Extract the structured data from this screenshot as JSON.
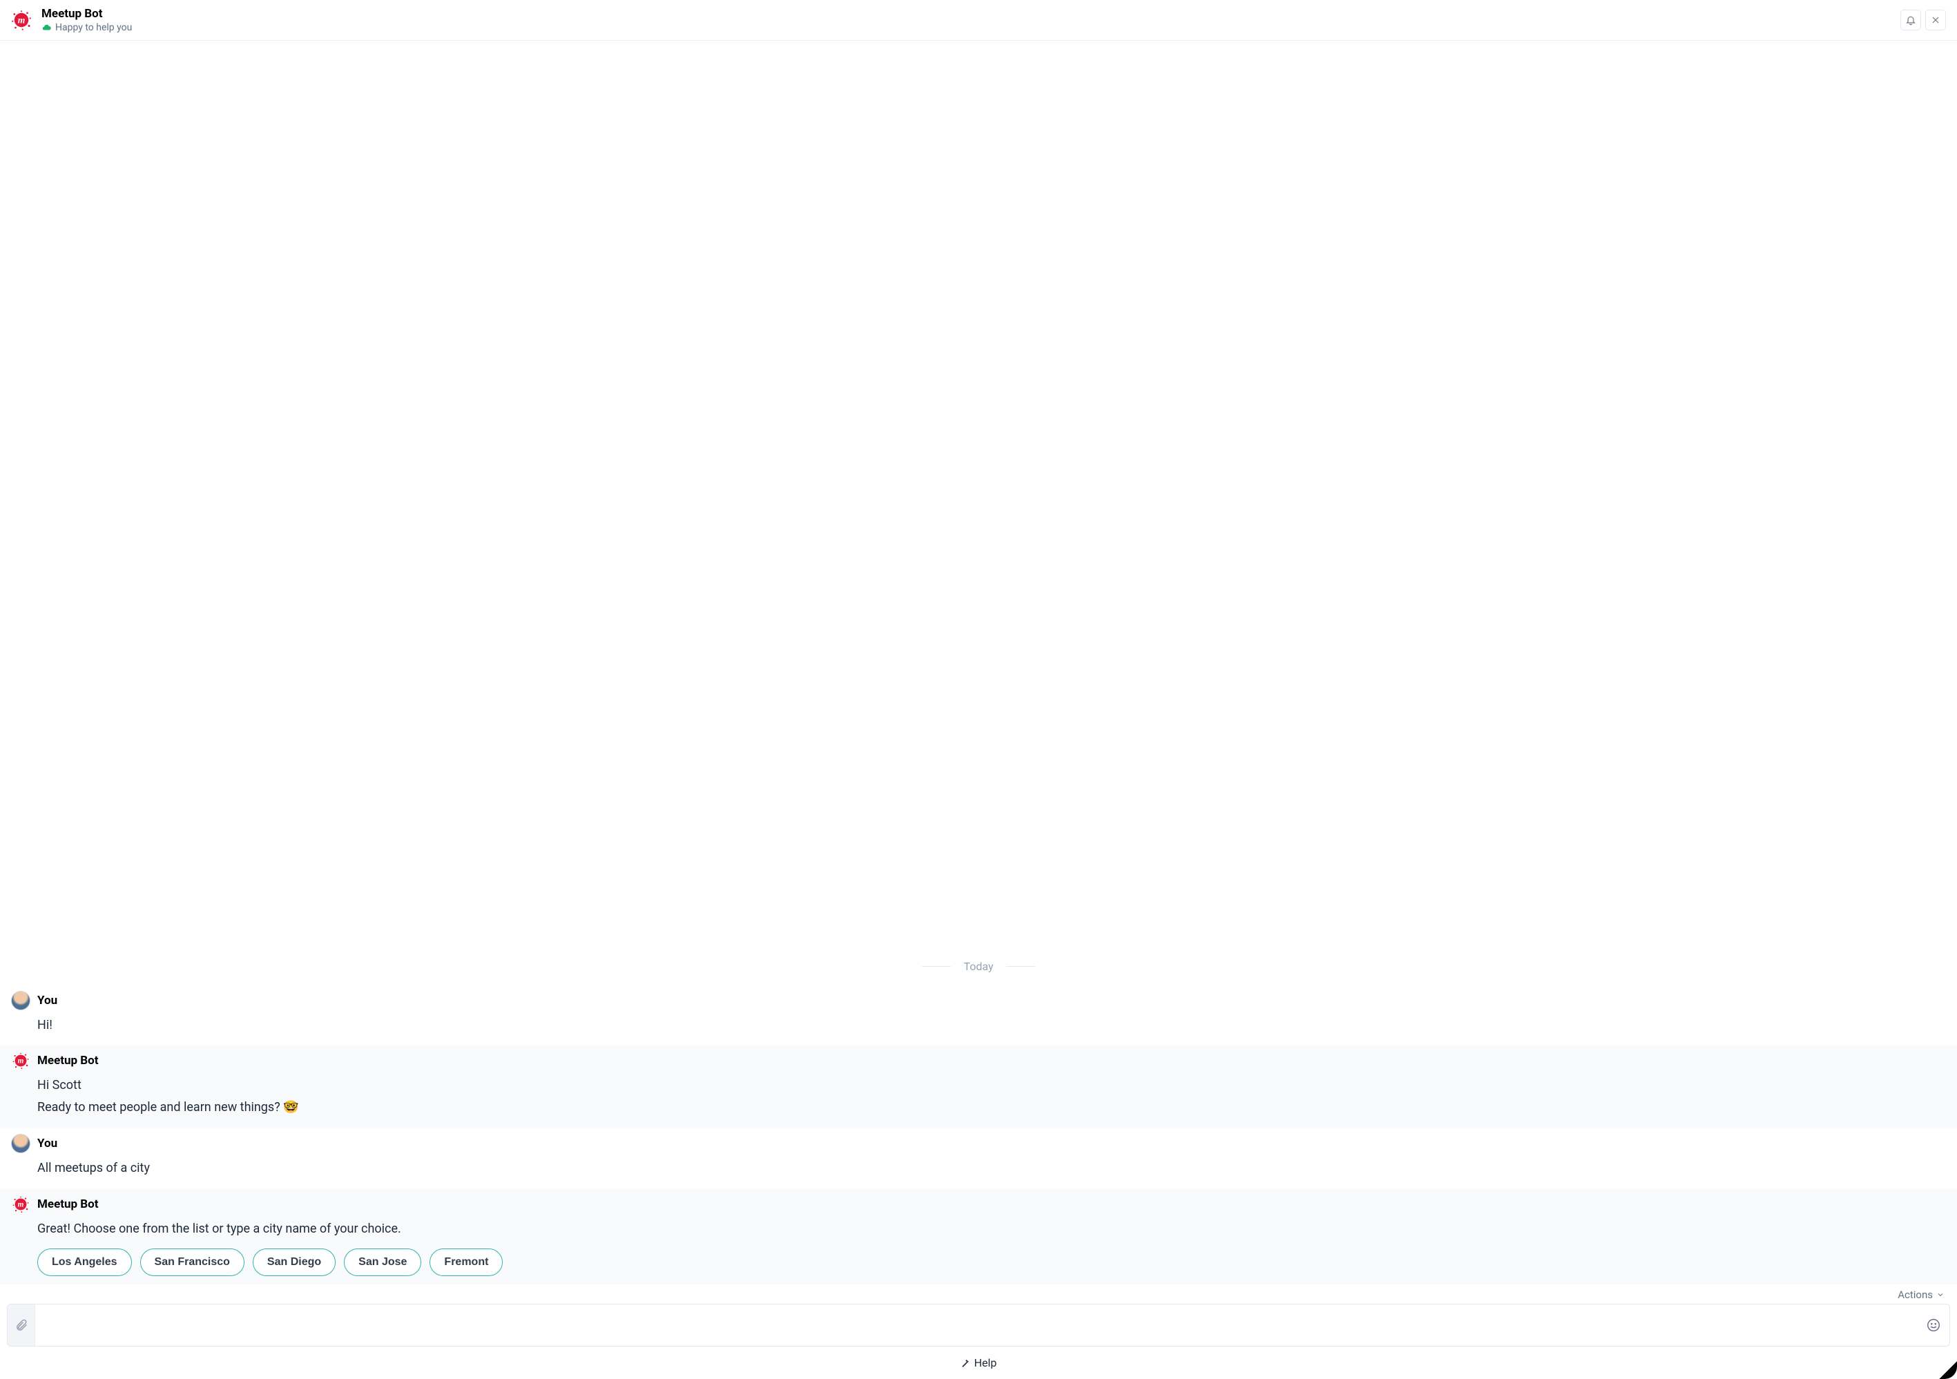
{
  "header": {
    "title": "Meetup Bot",
    "status_text": "Happy to help you"
  },
  "date_separator": "Today",
  "messages": [
    {
      "sender": "You",
      "kind": "user",
      "lines": [
        "Hi!"
      ]
    },
    {
      "sender": "Meetup Bot",
      "kind": "bot",
      "lines": [
        "Hi Scott",
        "Ready to meet people and learn new things? 🤓"
      ]
    },
    {
      "sender": "You",
      "kind": "user",
      "lines": [
        "All meetups of a city"
      ]
    },
    {
      "sender": "Meetup Bot",
      "kind": "bot",
      "lines": [
        "Great! Choose one from the list or type a city name of your choice."
      ],
      "chips": [
        "Los Angeles",
        "San Francisco",
        "San Diego",
        "San Jose",
        "Fremont"
      ]
    }
  ],
  "composer": {
    "placeholder": "",
    "actions_label": "Actions"
  },
  "help_label": "Help"
}
